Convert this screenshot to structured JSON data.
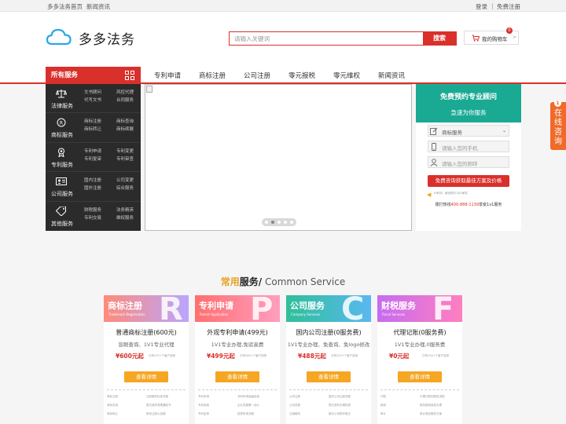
{
  "topbar": {
    "links": [
      "多多法务首页",
      "新闻资讯"
    ],
    "login": "登录",
    "divider": "|",
    "register": "免费注册"
  },
  "header": {
    "logo_text": "多多法务",
    "search_placeholder": "请输入关键词",
    "search_button": "搜索",
    "cart_label": "我的购物车",
    "cart_count": "0",
    "cart_arrow": ">"
  },
  "nav": {
    "all_services": "所有服务",
    "items": [
      "专利申请",
      "商标注册",
      "公司注册",
      "零元报税",
      "零元维权",
      "新闻资讯"
    ]
  },
  "side_menu": [
    {
      "title": "法律服务",
      "icon": "scales-icon",
      "links": [
        "文书顾问",
        "风控代理",
        "代写文书",
        "合同服务"
      ]
    },
    {
      "title": "商标服务",
      "icon": "registered-icon",
      "links": [
        "商标注册",
        "商标查询",
        "商标转让",
        "商标续展"
      ]
    },
    {
      "title": "专利服务",
      "icon": "medal-icon",
      "links": [
        "专利申请",
        "专利变更",
        "专利复审",
        "专利审查"
      ]
    },
    {
      "title": "公司服务",
      "icon": "id-card-icon",
      "links": [
        "国内注册",
        "公司变更",
        "国外注册",
        "综合服务"
      ]
    },
    {
      "title": "其他服务",
      "icon": "tag-icon",
      "links": [
        "财税服务",
        "法务精英",
        "专利交易",
        "维权服务"
      ]
    }
  ],
  "carousel": {
    "slide_count": 5,
    "active_index": 1
  },
  "consult": {
    "title": "免费预约专业顾问",
    "subtitle": "急速为你服务",
    "select_value": "商标服务",
    "phone_placeholder": "请输入您的手机",
    "name_placeholder": "请输入您的称呼",
    "submit": "免费咨询获取最佳方案及价格",
    "note": "10秒钟，最优顾问1对1解答",
    "hotline_prefix": "拨打热线",
    "hotline_number": "400-888-1139",
    "hotline_suffix": "享受1v1服务"
  },
  "online": {
    "badge": "1",
    "text": "在线咨询"
  },
  "section": {
    "title_part1": "常用",
    "title_part2": "服务/",
    "title_en": " Common Service"
  },
  "cards": [
    {
      "head": "商标注册",
      "head_en": "Trademark Registration",
      "letter": "R",
      "name": "普通商标注册(600元)",
      "desc": "盲眼查询、1V1专业代理",
      "price": "¥600元起",
      "sold": "已有470+个客户选择",
      "button": "查看详情",
      "lines": [
        [
          "商标注册",
          "注册服务标准流程"
        ],
        [
          "商标查询",
          "提交递件受理通知书"
        ],
        [
          "商标转让",
          "审查注册公告期"
        ]
      ]
    },
    {
      "head": "专利申请",
      "head_en": "Patent Application",
      "letter": "P",
      "name": "外观专利申请(499元)",
      "desc": "1V1专业办理,免驳高费",
      "price": "¥499元起",
      "sold": "已有280+个客户选择",
      "button": "查看详情",
      "lines": [
        [
          "专利申请",
          "专利申请高级检索"
        ],
        [
          "专利检索",
          "企业发展第一战斗"
        ],
        [
          "专利复审",
          "指导申请流程"
        ]
      ]
    },
    {
      "head": "公司服务",
      "head_en": "Company Services",
      "letter": "C",
      "name": "国内公司注册(0服务费)",
      "desc": "1V1专业办理、免查询、免logo修改",
      "price": "¥488元起",
      "sold": "已有229+个客户选择",
      "button": "查看详情",
      "lines": [
        [
          "公司注册",
          "国内公司注册流程"
        ],
        [
          "公司变更",
          "提交资料办理执照"
        ],
        [
          "注销服务",
          "新办公司税务登记"
        ]
      ]
    },
    {
      "head": "财税服务",
      "head_en": "Fiscal Services",
      "letter": "F",
      "name": "代理记账(0服务费)",
      "desc": "1V1专业办理,0服务费",
      "price": "¥0元起",
      "sold": "已有234+个客户选择",
      "button": "查看详情",
      "lines": [
        [
          "代账",
          "代理记账的服务流程"
        ],
        [
          "报税",
          "税务报税高效办理"
        ],
        [
          "审计",
          "审计报告服务方案"
        ]
      ]
    }
  ]
}
